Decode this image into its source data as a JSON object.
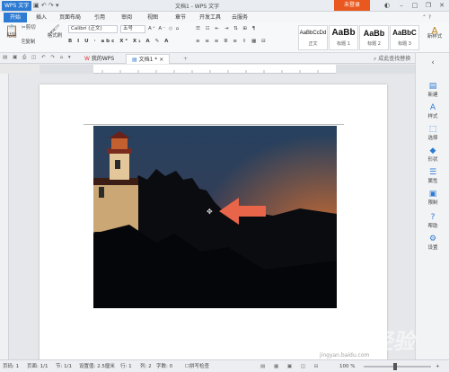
{
  "titlebar": {
    "app_logo": "WPS 文字",
    "doc_title": "文档1 - WPS 文字",
    "login": "未登录"
  },
  "menu": {
    "tabs": [
      "开始",
      "插入",
      "页面布局",
      "引用",
      "审阅",
      "视图",
      "章节",
      "开发工具",
      "云服务"
    ]
  },
  "ribbon": {
    "paste": "粘贴",
    "cut": "剪切",
    "copy": "复制",
    "format_painter": "格式刷",
    "font": "Calibri (正文)",
    "size": "五号",
    "styles": [
      {
        "preview": "AaBbCcDd",
        "caption": "正文"
      },
      {
        "preview": "AaBb",
        "caption": "标题 1"
      },
      {
        "preview": "AaBb",
        "caption": "标题 2"
      },
      {
        "preview": "AaBbC",
        "caption": "标题 3"
      }
    ],
    "new_style": "新样式",
    "find_replace": "成此查找替换"
  },
  "tabs": [
    "我的WPS",
    "文档1 *"
  ],
  "sidepanel": [
    {
      "icon": "new-icon",
      "label": "新建"
    },
    {
      "icon": "style-icon",
      "label": "样式"
    },
    {
      "icon": "select-icon",
      "label": "选择"
    },
    {
      "icon": "shape-icon",
      "label": "形状"
    },
    {
      "icon": "property-icon",
      "label": "属性"
    },
    {
      "icon": "limit-icon",
      "label": "限制"
    },
    {
      "icon": "help-icon",
      "label": "帮助"
    },
    {
      "icon": "settings-icon",
      "label": "设置"
    }
  ],
  "status": {
    "page": "页码: 1",
    "pages": "页面: 1/1",
    "section": "节: 1/1",
    "setting": "设置值: 2.5厘米",
    "row": "行: 1",
    "col": "列: 2",
    "words": "字数: 0",
    "spell": "拼写检查",
    "zoom": "100 %"
  },
  "watermark": {
    "main": "Baidu 经验",
    "sub": "jingyan.baidu.com"
  },
  "colors": {
    "accent": "#2d7bd2",
    "login": "#e9581e",
    "arrow": "#e8654a"
  }
}
